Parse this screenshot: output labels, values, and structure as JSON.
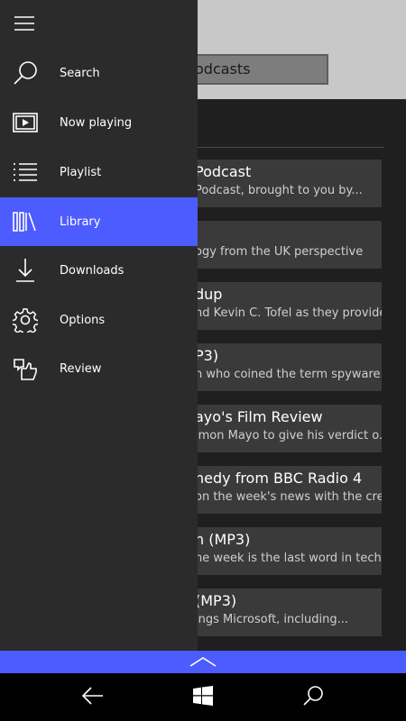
{
  "background": {
    "search_text": "odcasts",
    "podcasts": [
      {
        "title": "Podcast",
        "desc": "Podcast, brought to you by..."
      },
      {
        "title": "",
        "desc": "ogy from the UK perspective"
      },
      {
        "title": "dup",
        "desc": "nd Kevin C. Tofel as they provide..."
      },
      {
        "title": "P3)",
        "desc": "n who coined the term spyware..."
      },
      {
        "title": "ayo's Film Review",
        "desc": "imon Mayo to give his verdict o..."
      },
      {
        "title": "nedy from BBC Radio 4",
        "desc": "on the week's news with the crea..."
      },
      {
        "title": "n (MP3)",
        "desc": "he week is the last word in tech...."
      },
      {
        "title": " (MP3)",
        "desc": "ings Microsoft, including..."
      }
    ]
  },
  "nav": {
    "items": [
      {
        "label": "Search",
        "icon": "search-icon"
      },
      {
        "label": "Now playing",
        "icon": "now-playing-icon"
      },
      {
        "label": "Playlist",
        "icon": "playlist-icon"
      },
      {
        "label": "Library",
        "icon": "library-icon",
        "active": true
      },
      {
        "label": "Downloads",
        "icon": "download-icon"
      },
      {
        "label": "Options",
        "icon": "gear-icon"
      },
      {
        "label": "Review",
        "icon": "review-icon"
      }
    ]
  },
  "colors": {
    "accent": "#4d5cff",
    "nav_bg": "#2b2b2b",
    "card_bg": "#3a3a3a",
    "header_bg": "#c8c8c8"
  }
}
